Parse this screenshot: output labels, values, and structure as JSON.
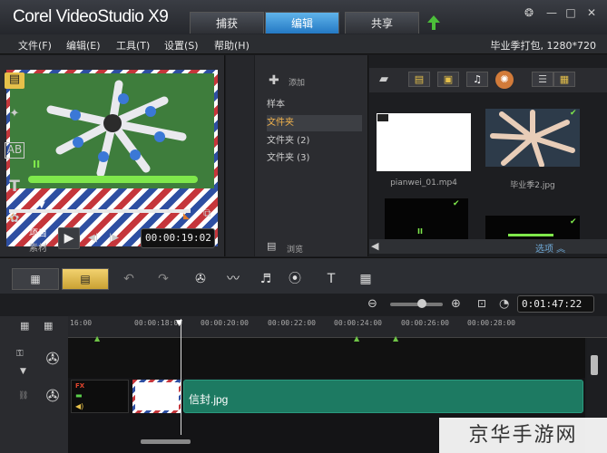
{
  "app": {
    "title": "Corel VideoStudio X9",
    "tabs": [
      "捕获",
      "编辑",
      "共享"
    ],
    "active_tab": "编辑"
  },
  "menu": {
    "items": [
      "文件(F)",
      "编辑(E)",
      "工具(T)",
      "设置(S)",
      "帮助(H)"
    ],
    "project_info": "毕业季打包, 1280*720"
  },
  "preview": {
    "mode_project": "项目",
    "mode_clip": "素材",
    "timecode": "00:00:19:02",
    "pause_glyph": "II"
  },
  "library": {
    "add_label": "添加",
    "folders": [
      "样本",
      "文件夹",
      "文件夹 (2)",
      "文件夹 (3)"
    ],
    "selected_folder": "文件夹",
    "browse_label": "浏览",
    "options_label": "选项",
    "items": [
      {
        "caption": "pianwei_01.mp4"
      },
      {
        "caption": "毕业季2.jpg"
      }
    ]
  },
  "timeline": {
    "duration": "0:01:47:22",
    "ruler": [
      "16:00",
      "00:00:18:00",
      "00:00:20:00",
      "00:00:22:00",
      "00:00:24:00",
      "00:00:26:00",
      "00:00:28:00"
    ],
    "clip_label": "信封.jpg",
    "clip_fx_label": "FX"
  },
  "watermark": "京华手游网"
}
